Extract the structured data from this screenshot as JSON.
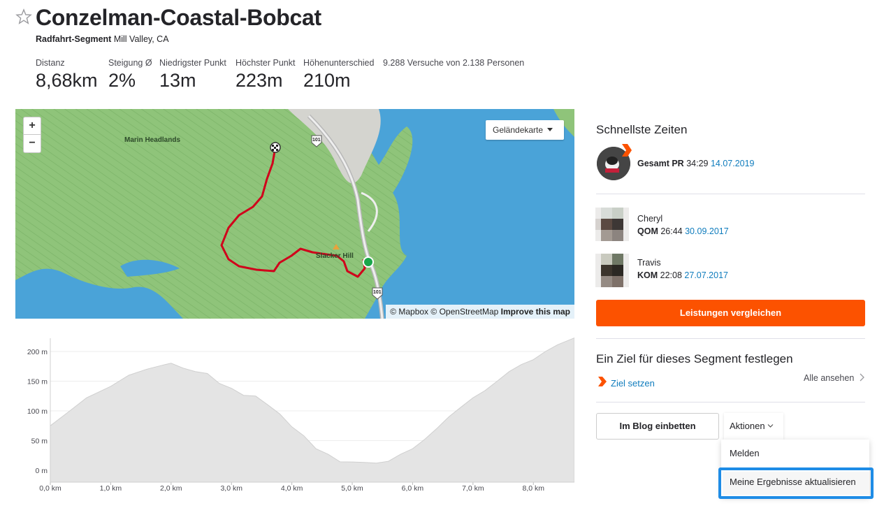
{
  "header": {
    "title": "Conzelman-Coastal-Bobcat",
    "segment_type": "Radfahrt-Segment",
    "location": "Mill Valley, CA"
  },
  "stats": [
    {
      "label": "Distanz",
      "value": "8,68km"
    },
    {
      "label": "Steigung Ø",
      "value": "2%"
    },
    {
      "label": "Niedrigster Punkt",
      "value": "13m"
    },
    {
      "label": "Höchster Punkt",
      "value": "223m"
    },
    {
      "label": "Höhenunterschied",
      "value": "210m"
    },
    {
      "label": "9.288 Versuche von 2.138 Personen",
      "value": ""
    }
  ],
  "map": {
    "zoom_in": "+",
    "zoom_out": "−",
    "type_select": "Geländekarte",
    "labels": {
      "headlands": "Marin Headlands",
      "hill": "Slacker Hill",
      "hwy1": "101",
      "hwy2": "101"
    },
    "attribution": {
      "mapbox": "© Mapbox",
      "osm": "© OpenStreetMap",
      "improve": "Improve this map"
    },
    "colors": {
      "water": "#4aa3d8",
      "land": "#8fc47a",
      "route": "#d0021b",
      "road": "#bdbdbd",
      "start_marker": "#1aa64a"
    }
  },
  "elevation_chart": {
    "y_labels": [
      "200 m",
      "150 m",
      "100 m",
      "50 m",
      "0 m"
    ],
    "x_labels": [
      "0,0 km",
      "1,0 km",
      "2,0 km",
      "3,0 km",
      "4,0 km",
      "5,0 km",
      "6,0 km",
      "7,0 km",
      "8,0 km"
    ]
  },
  "chart_data": {
    "type": "area",
    "x": [
      0,
      0.3,
      0.6,
      1.0,
      1.3,
      1.6,
      1.9,
      2.0,
      2.2,
      2.4,
      2.6,
      2.8,
      3.0,
      3.2,
      3.4,
      3.6,
      3.8,
      4.0,
      4.2,
      4.4,
      4.6,
      4.8,
      5.0,
      5.2,
      5.4,
      5.6,
      5.8,
      6.0,
      6.2,
      6.4,
      6.6,
      6.8,
      7.0,
      7.2,
      7.4,
      7.6,
      7.8,
      8.0,
      8.2,
      8.4,
      8.68
    ],
    "y": [
      75,
      100,
      122,
      143,
      160,
      172,
      178,
      182,
      172,
      168,
      163,
      148,
      138,
      128,
      125,
      112,
      95,
      75,
      58,
      38,
      27,
      16,
      14,
      15,
      12,
      17,
      27,
      38,
      52,
      72,
      90,
      108,
      122,
      136,
      150,
      168,
      178,
      188,
      200,
      213,
      223
    ],
    "xlim": [
      0,
      8.68
    ],
    "ylim": [
      -20,
      220
    ],
    "grid": true
  },
  "sidebar": {
    "fastest_title": "Schnellste Zeiten",
    "pr": {
      "label": "Gesamt PR",
      "time": "34:29",
      "date": "14.07.2019"
    },
    "qom": {
      "name": "Cheryl",
      "label": "QOM",
      "time": "26:44",
      "date": "30.09.2017"
    },
    "kom": {
      "name": "Travis",
      "label": "KOM",
      "time": "22:08",
      "date": "27.07.2017"
    },
    "compare_button": "Leistungen vergleichen",
    "goal_title": "Ein Ziel für dieses Segment festlegen",
    "goal_link": "Ziel setzen",
    "see_all": "Alle ansehen",
    "embed_button": "Im Blog einbetten",
    "actions_button": "Aktionen",
    "menu": {
      "report": "Melden",
      "refresh": "Meine Ergebnisse aktualisieren"
    },
    "accent": "#fc5200",
    "link_color": "#0f7cbd",
    "highlight_color": "#1e8ce6"
  }
}
